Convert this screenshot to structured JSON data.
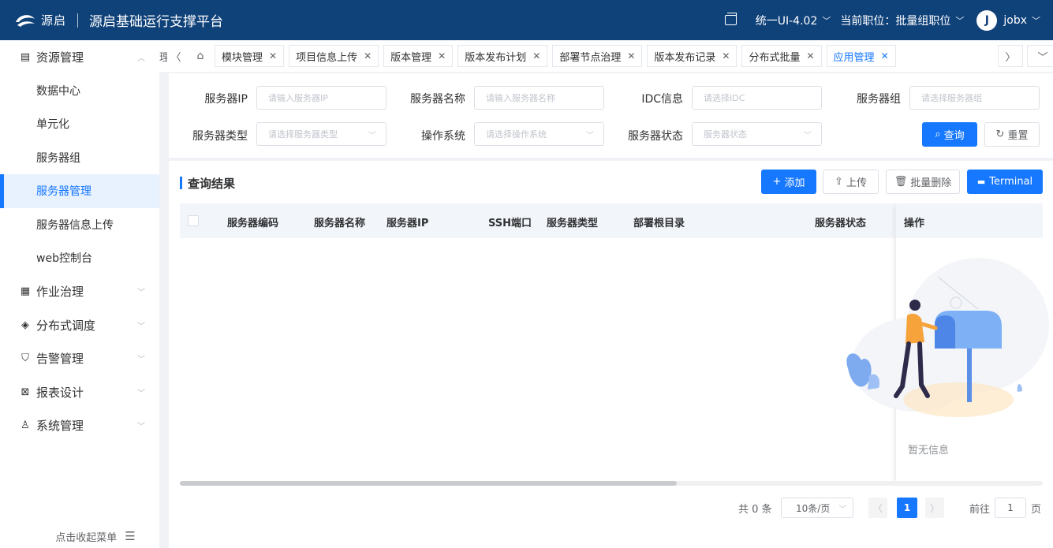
{
  "header": {
    "logo_text": "源启",
    "app_title": "源启基础运行支撑平台",
    "version": "统一UI-4.02",
    "position": "当前职位：批量组职位",
    "avatar_letter": "J",
    "username": "jobx"
  },
  "sidebar": {
    "group1": {
      "label": "资源管理",
      "icon": "server-icon"
    },
    "sub_items": [
      "数据中心",
      "单元化",
      "服务器组",
      "服务器管理",
      "服务器信息上传",
      "web控制台"
    ],
    "active_sub": "服务器管理",
    "groups": [
      {
        "label": "作业治理",
        "icon": "grid-icon"
      },
      {
        "label": "分布式调度",
        "icon": "layers-icon"
      },
      {
        "label": "告警管理",
        "icon": "shield-icon"
      },
      {
        "label": "报表设计",
        "icon": "chart-icon"
      },
      {
        "label": "系统管理",
        "icon": "user-icon"
      }
    ],
    "collapse_label": "点击收起菜单"
  },
  "tabs": {
    "partial": "理",
    "items": [
      "模块管理",
      "项目信息上传",
      "版本管理",
      "版本发布计划",
      "部署节点治理",
      "版本发布记录",
      "分布式批量",
      "应用管理"
    ],
    "active": "应用管理"
  },
  "filter": {
    "server_ip": {
      "label": "服务器IP",
      "placeholder": "请输入服务器IP"
    },
    "server_name": {
      "label": "服务器名称",
      "placeholder": "请输入服务器名称"
    },
    "idc": {
      "label": "IDC信息",
      "placeholder": "请选择IDC"
    },
    "server_group": {
      "label": "服务器组",
      "placeholder": "请选择服务器组"
    },
    "server_type": {
      "label": "服务器类型",
      "placeholder": "请选择服务器类型"
    },
    "os": {
      "label": "操作系统",
      "placeholder": "请选择操作系统"
    },
    "status": {
      "label": "服务器状态",
      "placeholder": "服务器状态"
    },
    "query_button": "查询",
    "reset_button": "重置"
  },
  "results": {
    "title": "查询结果",
    "add_button": "添加",
    "upload_button": "上传",
    "batch_delete_button": "批量删除",
    "terminal_button": "Terminal",
    "columns": [
      "服务器编码",
      "服务器名称",
      "服务器IP",
      "SSH端口",
      "服务器类型",
      "部署根目录",
      "服务器状态",
      "操作"
    ],
    "empty_text": "暂无信息"
  },
  "pagination": {
    "total": "共 0 条",
    "page_size": "10条/页",
    "current_page": "1",
    "goto_label": "前往",
    "goto_value": "1",
    "page_suffix": "页"
  },
  "colors": {
    "header_bg": "#10427a",
    "accent": "#1677ff"
  }
}
